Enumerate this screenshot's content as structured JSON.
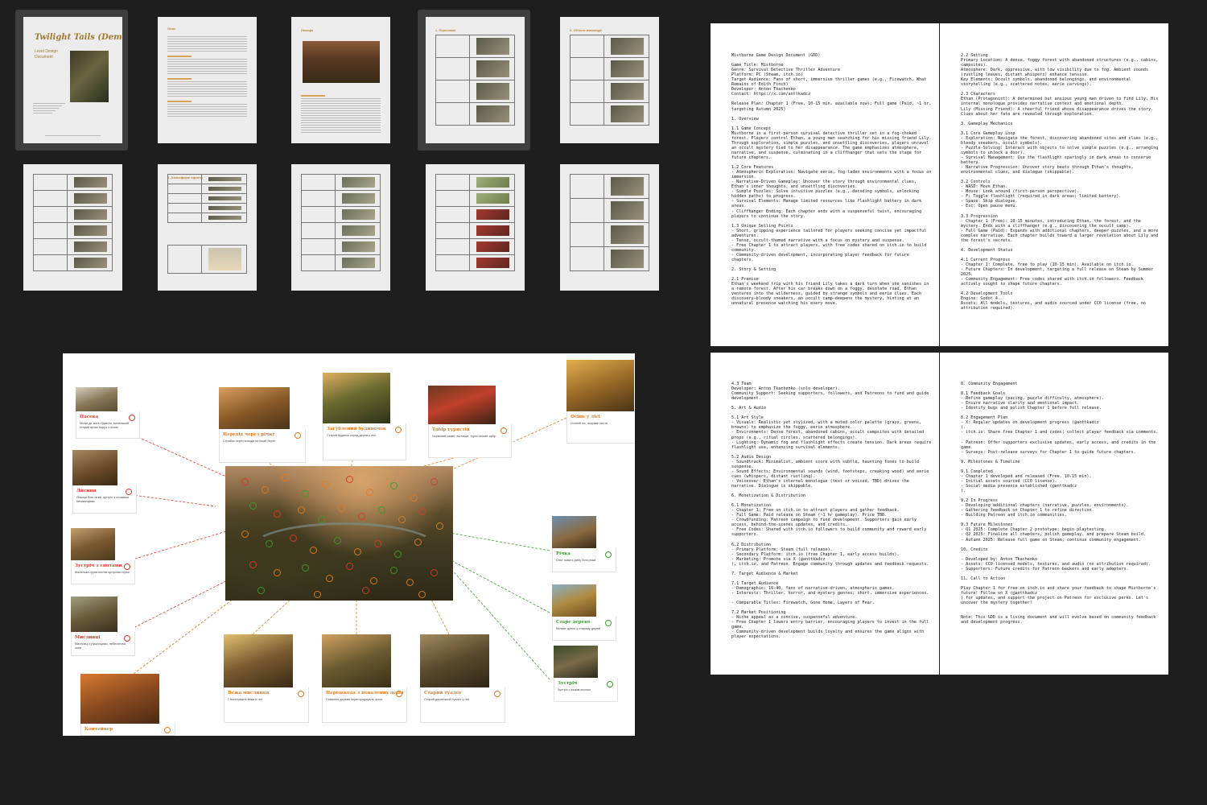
{
  "colors": {
    "accent_orange": "#e07b22",
    "accent_red": "#d43a2a",
    "accent_green": "#3c9a2e",
    "title_gold": "#a0782e"
  },
  "slides": [
    {
      "id": 1,
      "title": "Twilight Tails (Demo)",
      "subtitle": "Level Design Document",
      "selected": true
    },
    {
      "id": 2,
      "heading": "Опис"
    },
    {
      "id": 3,
      "heading": "Локація"
    },
    {
      "id": 4,
      "heading": "1. Персонажі",
      "selected": true
    },
    {
      "id": 5,
      "heading": "2. Об'єкти взаємодії"
    },
    {
      "id": 6
    },
    {
      "id": 7,
      "heading": "3. Атмосферні ефекти"
    },
    {
      "id": 8
    },
    {
      "id": 9
    },
    {
      "id": 10
    }
  ],
  "gdd_pages": [
    {
      "lines": [
        "Mistborne Game Design Document (GDD)",
        "",
        "Game Title: Mistborne",
        "Genre: Survival Detective Thriller Adventure",
        "Platform: PC (Steam, itch.io)",
        "Target Audience: Fans of short, immersive thriller games (e.g., Firewatch, What",
        "Remains of Edith Finch)",
        "Developer: Anton Tkachenko",
        "Contact: https://x.com/anttkadcz",
        "",
        "Release Plan: Chapter 1 (Free, 10-15 min, available now); Full game (Paid, ~1 hr,",
        "targeting Autumn 2025)",
        "",
        "1. Overview",
        "",
        "1.1 Game Concept",
        "Mistborne is a first-person survival detective thriller set in a fog-choked",
        "forest. Players control Ethan, a young man searching for his missing friend Lily.",
        "Through exploration, simple puzzles, and unsettling discoveries, players unravel",
        "an occult mystery tied to her disappearance. The game emphasizes atmosphere,",
        "narrative, and suspense, culminating in a cliffhanger that sets the stage for",
        "future chapters.",
        "",
        "1.2 Core Features",
        "- Atmospheric Exploration: Navigate eerie, fog-laden environments with a focus on",
        "immersion.",
        "- Narrative-Driven Gameplay: Uncover the story through environmental clues,",
        "Ethan's inner thoughts, and unsettling discoveries.",
        "- Simple Puzzles: Solve intuitive puzzles (e.g., decoding symbols, unlocking",
        "hidden paths) to progress.",
        "- Survival Elements: Manage limited resources like flashlight battery in dark",
        "areas.",
        "- Cliffhanger Ending: Each chapter ends with a suspenseful twist, encouraging",
        "players to continue the story.",
        "",
        "1.3 Unique Selling Points",
        "- Short, gripping experience tailored for players seeking concise yet impactful",
        "adventures.",
        "- Tense, occult-themed narrative with a focus on mystery and suspense.",
        "- Free Chapter 1 to attract players, with free codes shared on itch.io to build",
        "community.",
        "- Community-driven development, incorporating player feedback for future",
        "chapters.",
        "",
        "2. Story & Setting",
        "",
        "2.1 Premise",
        "Ethan's weekend trip with his friend Lily takes a dark turn when she vanishes in",
        "a remote forest. After his car breaks down on a foggy, desolate road, Ethan",
        "ventures into the wilderness, guided by strange symbols and eerie clues. Each",
        "discovery—bloody sneakers, an occult camp—deepens the mystery, hinting at an",
        "unnatural presence watching his every move."
      ]
    },
    {
      "lines": [
        "2.2 Setting",
        "Primary Location: A dense, foggy forest with abandoned structures (e.g., cabins,",
        "campsites).",
        "Atmosphere: Dark, oppressive, with low visibility due to fog. Ambient sounds",
        "(rustling leaves, distant whispers) enhance tension.",
        "Key Elements: Occult symbols, abandoned belongings, and environmental",
        "storytelling (e.g., scattered notes, eerie carvings).",
        "",
        "2.3 Characters",
        "Ethan (Protagonist): A determined but anxious young man driven to find Lily. His",
        "internal monologue provides narrative context and emotional depth.",
        "Lily (Missing Friend): A cheerful friend whose disappearance drives the story.",
        "Clues about her fate are revealed through exploration.",
        "",
        "3. Gameplay Mechanics",
        "",
        "3.1 Core Gameplay Loop",
        "- Exploration: Navigate the forest, discovering abandoned sites and clues (e.g.,",
        "bloody sneakers, occult symbols).",
        "- Puzzle-Solving: Interact with objects to solve simple puzzles (e.g., arranging",
        "symbols to unlock a door).",
        "- Survival Management: Use the flashlight sparingly in dark areas to conserve",
        "battery.",
        "- Narrative Progression: Uncover story beats through Ethan's thoughts,",
        "environmental clues, and dialogue (skippable).",
        "",
        "3.2 Controls",
        "- WASD: Move Ethan.",
        "- Mouse: Look around (first-person perspective).",
        "- F: Toggle flashlight (required in dark areas; limited battery).",
        "- Space: Skip dialogue.",
        "- Esc: Open pause menu.",
        "",
        "3.3 Progression",
        "- Chapter 1 (Free): 10-15 minutes, introducing Ethan, the forest, and the",
        "mystery. Ends with a cliffhanger (e.g., discovering the occult camp).",
        "- Full Game (Paid): Expands with additional chapters, deeper puzzles, and a more",
        "complex narrative. Each chapter builds toward a larger revelation about Lily and",
        "the forest's secrets.",
        "",
        "4. Development Status",
        "",
        "4.1 Current Progress",
        "- Chapter 1: Complete, free to play (10-15 min). Available on itch.io.",
        "- Future Chapters: In development, targeting a full release on Steam by Summer",
        "2025.",
        "- Community Engagement: Free codes shared with itch.io followers. Feedback",
        "actively sought to shape future chapters.",
        "",
        "4.2 Development Tools",
        "Engine: Godot 4.",
        "Assets: All models, textures, and audio sourced under CC0 license (free, no",
        "attribution required)."
      ]
    },
    {
      "lines": [
        "4.3 Team",
        "Developer: Anton Tkachenko (solo developer).",
        "Community Support: Seeking supporters, followers, and Patreons to fund and guide",
        "development.",
        "",
        "5. Art & Audio",
        "",
        "5.1 Art Style",
        "- Visuals: Realistic yet stylized, with a muted color palette (grays, greens,",
        "browns) to emphasize the foggy, eerie atmosphere.",
        "- Environments: Dense forest, abandoned cabins, occult campsites with detailed",
        "props (e.g., ritual circles, scattered belongings).",
        "- Lighting: Dynamic fog and flashlight effects create tension. Dark areas require",
        "flashlight use, enhancing survival elements.",
        "",
        "5.2 Audio Design",
        "- Soundtrack: Minimalist, ambient score with subtle, haunting tones to build",
        "suspense.",
        "- Sound Effects: Environmental sounds (wind, footsteps, creaking wood) and eerie",
        "cues (whispers, distant rustling).",
        "- Voiceover: Ethan's internal monologue (text or voiced, TBD) drives the",
        "narrative. Dialogue is skippable.",
        "",
        "6. Monetization & Distribution",
        "",
        "6.1 Monetization",
        "- Chapter 1: Free on itch.io to attract players and gather feedback.",
        "- Full Game: Paid release on Steam (~1 hr gameplay). Price TBD.",
        "- Crowdfunding: Patreon campaign to fund development. Supporters gain early",
        "access, behind-the-scenes updates, and credits.",
        "- Free Codes: Shared with itch.io followers to build community and reward early",
        "supporters.",
        "",
        "6.2 Distribution",
        "- Primary Platform: Steam (full release).",
        "- Secondary Platform: itch.io (free Chapter 1, early access builds).",
        "- Marketing: Promote via X (@anttkadcz",
        "), itch.io, and Patreon. Engage community through updates and feedback requests.",
        "",
        "7. Target Audience & Market",
        "",
        "7.1 Target Audience",
        "- Demographic: 16-40, fans of narrative-driven, atmospheric games.",
        "- Interests: Thriller, horror, and mystery genres; short, immersive experiences.",
        "",
        "- Comparable Titles: Firewatch, Gone Home, Layers of Fear.",
        "",
        "7.2 Market Positioning",
        "- Niche appeal as a concise, suspenseful adventure.",
        "- Free Chapter 1 lowers entry barrier, encouraging players to invest in the full",
        "game.",
        "- Community-driven development builds loyalty and ensures the game aligns with",
        "player expectations."
      ]
    },
    {
      "lines": [
        "8. Community Engagement",
        "",
        "8.1 Feedback Goals",
        "- Refine gameplay (pacing, puzzle difficulty, atmosphere).",
        "- Ensure narrative clarity and emotional impact.",
        "- Identify bugs and polish Chapter 1 before full release.",
        "",
        "8.2 Engagement Plan",
        "- X: Regular updates on development progress (@anttkadcz",
        ").",
        "- itch.io: Share free Chapter 1 and codes; collect player feedback via comments.",
        "",
        "- Patreon: Offer supporters exclusive updates, early access, and credits in the",
        "game.",
        "- Surveys: Post-release surveys for Chapter 1 to guide future chapters.",
        "",
        "9. Milestones & Timeline",
        "",
        "9.1 Completed",
        "- Chapter 1 developed and released (Free, 10-15 min).",
        "- Initial assets sourced (CC0 license).",
        "- Social media presence established (@anttkadcz",
        ").",
        "",
        "9.2 In Progress",
        "- Developing additional chapters (narrative, puzzles, environments).",
        "- Gathering feedback on Chapter 1 to refine direction.",
        "- Building Patreon and itch.io communities.",
        "",
        "9.3 Future Milestones",
        "- Q1 2025: Complete Chapter 2 prototype; begin playtesting.",
        "- Q2 2025: Finalize all chapters, polish gameplay, and prepare Steam build.",
        "- Autumn 2025: Release full game on Steam; continue community engagement.",
        "",
        "10. Credits",
        "",
        "- Developed by: Anton Tkachenko",
        "- Assets: CC0-licensed models, textures, and audio (no attribution required).",
        "- Supporters: Future credits for Patreon backers and early adopters.",
        "",
        "11. Call to Action",
        "",
        "Play Chapter 1 for free on itch.io and share your feedback to shape Mistborne's",
        "future! Follow on X (@anttkadcz",
        ") for updates, and support the project on Patreon for exclusive perks. Let's",
        "uncover the mystery together!",
        "",
        "",
        "Note: This GDD is a living document and will evolve based on community feedback",
        "and development progress."
      ]
    }
  ],
  "board": {
    "cards": [
      {
        "name": "Пасека",
        "color": "red",
        "desc": "Місце де жили бджоли, маленький старий вулик поруч з лісом"
      },
      {
        "name": "Лисиця",
        "color": "red",
        "desc": "Лисиця біля лігва, зустріч з лісовими мешканцями"
      },
      {
        "name": "Зустріч з єнотами",
        "color": "red",
        "desc": "Маленька група єнотів зустрічає героя"
      },
      {
        "name": "Мисливці",
        "color": "red",
        "desc": "Мисливці з рушницями, небезпечна зона"
      },
      {
        "name": "Перехід через річку",
        "color": "orange",
        "desc": "Стрибок через колоди на іншій берег"
      },
      {
        "name": "Загублений будиночок",
        "color": "orange",
        "desc": "Старий будинок серед дерев у лісі"
      },
      {
        "name": "Табір туристів",
        "color": "orange",
        "desc": "Червоний намет, вогнище, туристичний табір"
      },
      {
        "name": "Осінь у лісі",
        "color": "orange",
        "desc": "Осінній ліс, яскраве листя"
      },
      {
        "name": "Річка",
        "color": "green",
        "desc": "Єнот ловить рибу біля річки"
      },
      {
        "name": "Старе дерево",
        "color": "green",
        "desc": "Велике дупло у старому дереві"
      },
      {
        "name": "Зустріч",
        "color": "green",
        "desc": "Зустріч з іншим єнотом"
      },
      {
        "name": "Вежа мисливця",
        "color": "orange",
        "desc": "Спостережна вежа в лісі"
      },
      {
        "name": "Перешкода з повалених дерев",
        "color": "orange",
        "desc": "Повалені дерева перегороджують шлях"
      },
      {
        "name": "Старий туалет",
        "color": "orange",
        "desc": "Старий дерев'яний туалет у лісі"
      },
      {
        "name": "Контейнер",
        "color": "orange",
        "desc": ""
      }
    ]
  }
}
